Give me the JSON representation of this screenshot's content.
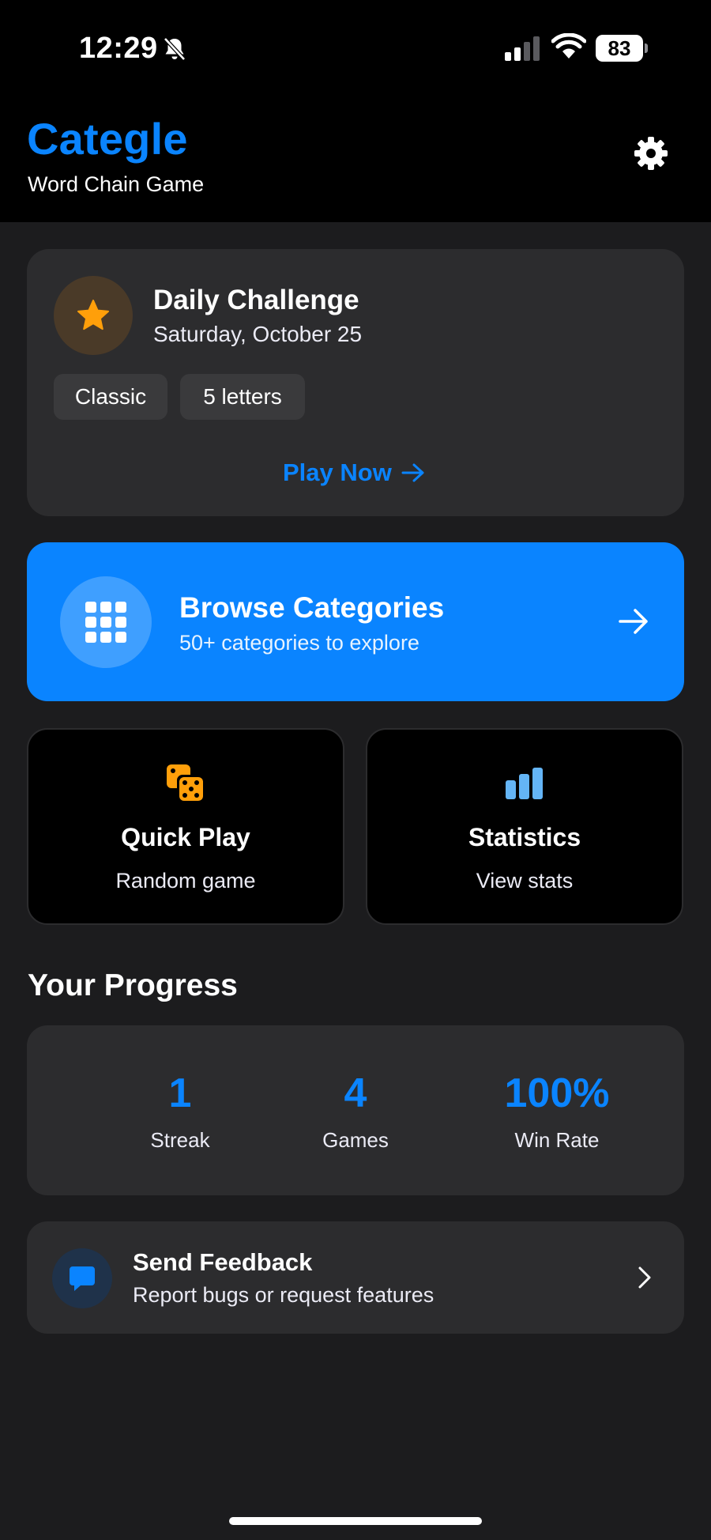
{
  "status_bar": {
    "time": "12:29",
    "battery": "83",
    "icons": [
      "bell-slash-icon",
      "cellular-signal-icon",
      "wifi-icon",
      "battery-icon"
    ]
  },
  "header": {
    "title": "Categle",
    "subtitle": "Word Chain Game",
    "settings_icon": "gear-icon"
  },
  "daily_challenge": {
    "icon": "star-icon",
    "title": "Daily Challenge",
    "date": "Saturday, October 25",
    "tags": [
      "Classic",
      "5 letters"
    ],
    "action": "Play Now"
  },
  "browse": {
    "icon": "grid-icon",
    "title": "Browse Categories",
    "subtitle": "50+ categories to explore"
  },
  "tiles": [
    {
      "icon": "dice-icon",
      "title": "Quick Play",
      "subtitle": "Random game"
    },
    {
      "icon": "bar-chart-icon",
      "title": "Statistics",
      "subtitle": "View stats"
    }
  ],
  "progress": {
    "title": "Your Progress",
    "stats": [
      {
        "value": "1",
        "label": "Streak"
      },
      {
        "value": "4",
        "label": "Games"
      },
      {
        "value": "100%",
        "label": "Win Rate"
      }
    ]
  },
  "feedback": {
    "icon": "chat-bubble-icon",
    "title": "Send Feedback",
    "subtitle": "Report bugs or request features"
  },
  "colors": {
    "accent": "#0a84ff",
    "background": "#1c1c1e",
    "card": "#2c2c2e",
    "star": "#ff9f0a",
    "dice": "#ff9f0a",
    "stats_icon": "#64b5f6"
  }
}
